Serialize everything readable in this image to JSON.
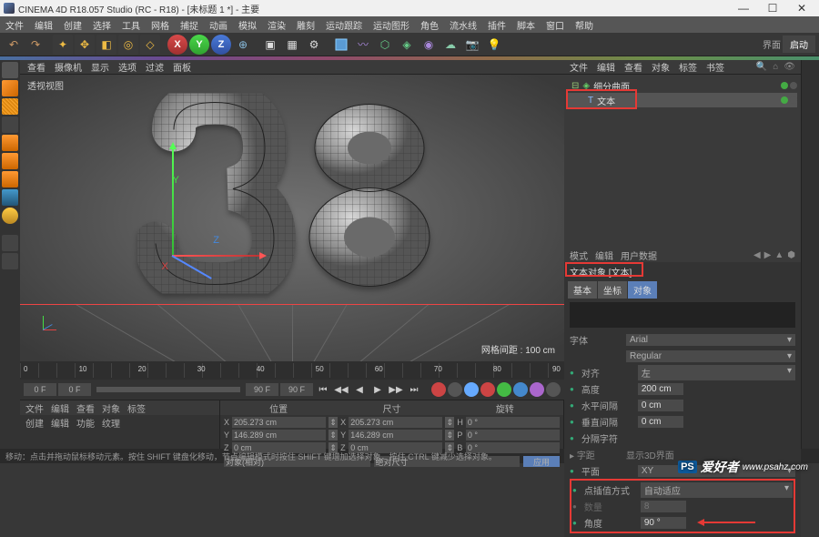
{
  "titlebar": {
    "title": "CINEMA 4D R18.057 Studio (RC - R18) - [未标题 1 *] - 主要"
  },
  "winbtns": {
    "min": "—",
    "max": "☐",
    "close": "✕"
  },
  "menubar": [
    "文件",
    "编辑",
    "创建",
    "选择",
    "工具",
    "网格",
    "捕捉",
    "动画",
    "模拟",
    "渲染",
    "雕刻",
    "运动跟踪",
    "运动图形",
    "角色",
    "流水线",
    "插件",
    "脚本",
    "窗口",
    "帮助"
  ],
  "axis": {
    "x": "X",
    "y": "Y",
    "z": "Z"
  },
  "layout": {
    "label": "界面",
    "value": "启动"
  },
  "vp_tabs": [
    "查看",
    "摄像机",
    "显示",
    "选项",
    "过滤",
    "面板"
  ],
  "vp_label": "透视视图",
  "hud": {
    "label": "网格间距 :",
    "value": "100 cm"
  },
  "right_tabs1": [
    "文件",
    "编辑",
    "查看",
    "对象",
    "标签",
    "书签"
  ],
  "obj_tree": {
    "root": "细分曲面",
    "child": "文本"
  },
  "attr_head": [
    "模式",
    "编辑",
    "用户数据"
  ],
  "attr_title": "文本对象 [文本]",
  "attr_tabs": [
    "基本",
    "坐标",
    "对象"
  ],
  "props": {
    "font_label": "字体",
    "font_value": "Arial",
    "font_style": "Regular",
    "align_label": "对齐",
    "align_value": "左",
    "height_label": "高度",
    "height_value": "200 cm",
    "hspace_label": "水平间隔",
    "hspace_value": "0 cm",
    "vspace_label": "垂直间隔",
    "vspace_value": "0 cm",
    "sep_label": "分隔字符",
    "kerning_label": "字距",
    "kerning_sub": "显示3D界面",
    "plane_label": "平面",
    "plane_value": "XY",
    "interp_label": "点插值方式",
    "interp_value": "自动适应",
    "count_label": "数量",
    "count_value": "8",
    "angle_label": "角度",
    "angle_value": "90 °"
  },
  "timeline": {
    "ticks": [
      "0",
      "10",
      "20",
      "30",
      "40",
      "50",
      "60",
      "70",
      "80",
      "90"
    ]
  },
  "controls": {
    "start": "0 F",
    "cur": "0 F",
    "end1": "90 F",
    "end2": "90 F"
  },
  "mat_tabs": [
    "文件",
    "编辑",
    "查看",
    "对象",
    "标签"
  ],
  "mat_sub": [
    "创建",
    "编辑",
    "功能",
    "纹理"
  ],
  "coord_tabs": [
    "位置",
    "尺寸",
    "旋转"
  ],
  "coord": {
    "x": "205.273 cm",
    "y": "146.289 cm",
    "z": "0 cm",
    "sx": "205.273 cm",
    "sy": "146.289 cm",
    "sz": "0 cm",
    "h": "0 °",
    "p": "0 °",
    "b": "0 °",
    "mode1": "对象(相对)",
    "mode2": "绝对尺寸",
    "apply": "应用"
  },
  "status": "移动：点击并拖动鼠标移动元素。按住 SHIFT 键盘化移动，节点编辑模式时按住 SHIFT 键增加选择对象，按住 CTRL 键减少选择对象。",
  "watermark": {
    "ps": "PS",
    "text": "爱好者",
    "url": "www.psahz.com"
  }
}
